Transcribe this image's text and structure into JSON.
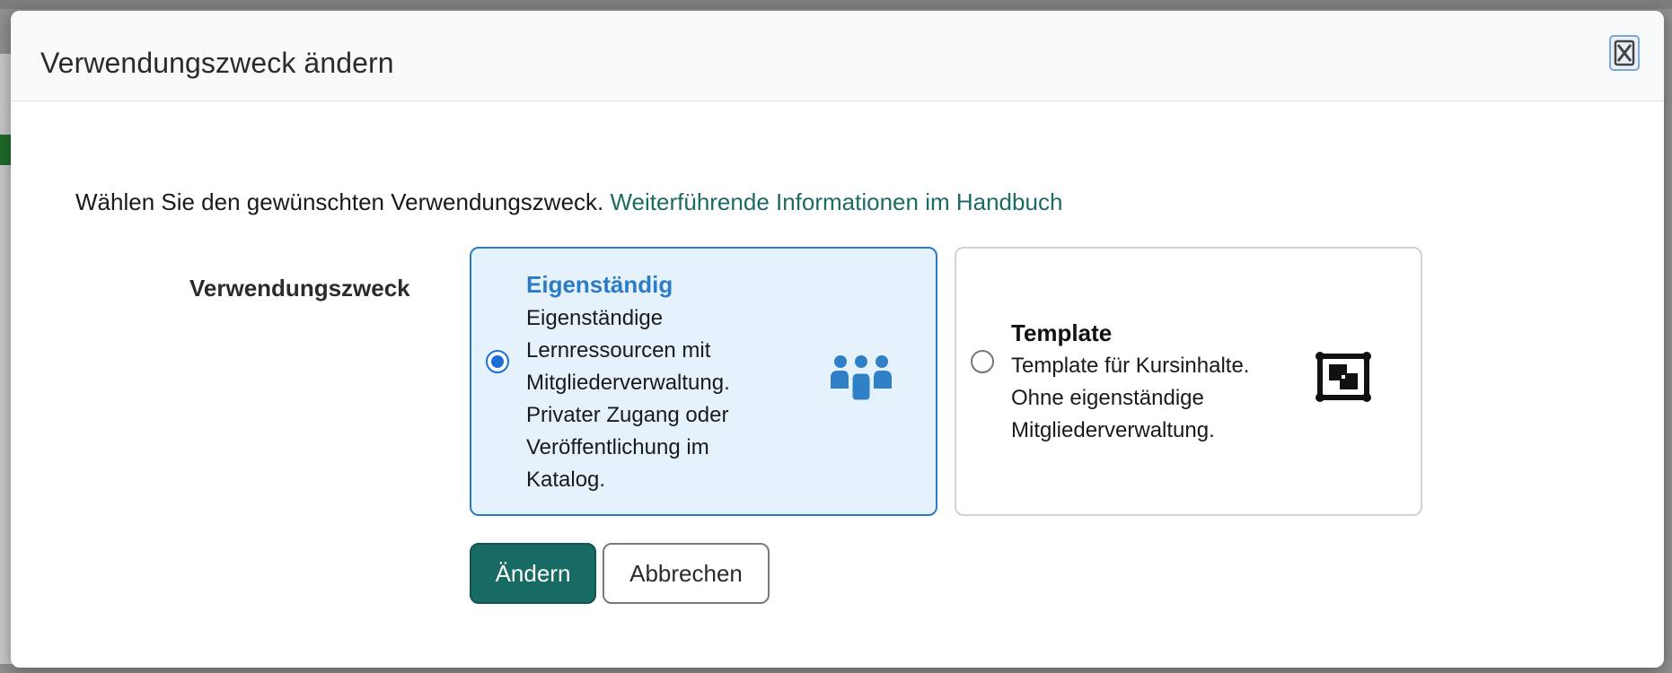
{
  "dialog": {
    "title": "Verwendungszweck ändern",
    "close_icon": "close-icon"
  },
  "intro": {
    "text": "Wählen Sie den gewünschten Verwendungszweck.",
    "link": "Weiterführende Informationen im Handbuch"
  },
  "field": {
    "label": "Verwendungszweck"
  },
  "options": [
    {
      "title": "Eigenständig",
      "description": "Eigenständige Lernressourcen mit Mitgliederverwaltung. Privater Zugang oder Veröffentlichung im Katalog.",
      "icon": "users-icon",
      "selected": true
    },
    {
      "title": "Template",
      "description": "Template für Kursinhalte. Ohne eigenständige Mitgliederverwaltung.",
      "icon": "template-icon",
      "selected": false
    }
  ],
  "buttons": {
    "submit_label": "Ändern",
    "cancel_label": "Abbrechen"
  },
  "colors": {
    "accent": "#186a64",
    "link": "#1c6b63",
    "selected_border": "#2b7bc6",
    "selected_bg": "#e6f2fb",
    "icon_blue": "#2f80c7"
  }
}
